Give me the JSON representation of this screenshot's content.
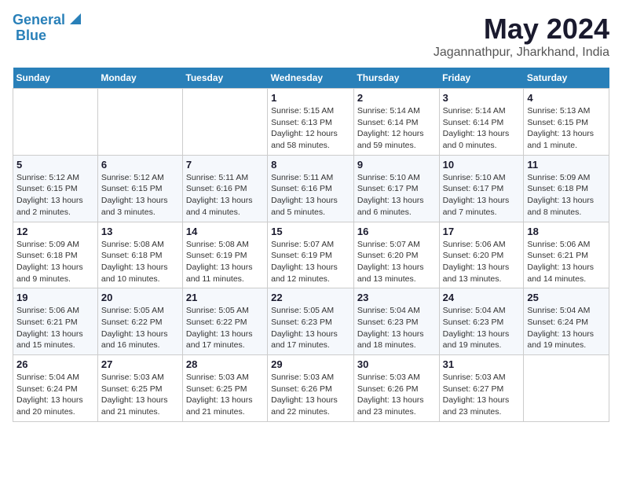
{
  "header": {
    "logo_line1": "General",
    "logo_line2": "Blue",
    "month": "May 2024",
    "location": "Jagannathpur, Jharkhand, India"
  },
  "weekdays": [
    "Sunday",
    "Monday",
    "Tuesday",
    "Wednesday",
    "Thursday",
    "Friday",
    "Saturday"
  ],
  "weeks": [
    [
      {
        "day": "",
        "info": ""
      },
      {
        "day": "",
        "info": ""
      },
      {
        "day": "",
        "info": ""
      },
      {
        "day": "1",
        "info": "Sunrise: 5:15 AM\nSunset: 6:13 PM\nDaylight: 12 hours\nand 58 minutes."
      },
      {
        "day": "2",
        "info": "Sunrise: 5:14 AM\nSunset: 6:14 PM\nDaylight: 12 hours\nand 59 minutes."
      },
      {
        "day": "3",
        "info": "Sunrise: 5:14 AM\nSunset: 6:14 PM\nDaylight: 13 hours\nand 0 minutes."
      },
      {
        "day": "4",
        "info": "Sunrise: 5:13 AM\nSunset: 6:15 PM\nDaylight: 13 hours\nand 1 minute."
      }
    ],
    [
      {
        "day": "5",
        "info": "Sunrise: 5:12 AM\nSunset: 6:15 PM\nDaylight: 13 hours\nand 2 minutes."
      },
      {
        "day": "6",
        "info": "Sunrise: 5:12 AM\nSunset: 6:15 PM\nDaylight: 13 hours\nand 3 minutes."
      },
      {
        "day": "7",
        "info": "Sunrise: 5:11 AM\nSunset: 6:16 PM\nDaylight: 13 hours\nand 4 minutes."
      },
      {
        "day": "8",
        "info": "Sunrise: 5:11 AM\nSunset: 6:16 PM\nDaylight: 13 hours\nand 5 minutes."
      },
      {
        "day": "9",
        "info": "Sunrise: 5:10 AM\nSunset: 6:17 PM\nDaylight: 13 hours\nand 6 minutes."
      },
      {
        "day": "10",
        "info": "Sunrise: 5:10 AM\nSunset: 6:17 PM\nDaylight: 13 hours\nand 7 minutes."
      },
      {
        "day": "11",
        "info": "Sunrise: 5:09 AM\nSunset: 6:18 PM\nDaylight: 13 hours\nand 8 minutes."
      }
    ],
    [
      {
        "day": "12",
        "info": "Sunrise: 5:09 AM\nSunset: 6:18 PM\nDaylight: 13 hours\nand 9 minutes."
      },
      {
        "day": "13",
        "info": "Sunrise: 5:08 AM\nSunset: 6:18 PM\nDaylight: 13 hours\nand 10 minutes."
      },
      {
        "day": "14",
        "info": "Sunrise: 5:08 AM\nSunset: 6:19 PM\nDaylight: 13 hours\nand 11 minutes."
      },
      {
        "day": "15",
        "info": "Sunrise: 5:07 AM\nSunset: 6:19 PM\nDaylight: 13 hours\nand 12 minutes."
      },
      {
        "day": "16",
        "info": "Sunrise: 5:07 AM\nSunset: 6:20 PM\nDaylight: 13 hours\nand 13 minutes."
      },
      {
        "day": "17",
        "info": "Sunrise: 5:06 AM\nSunset: 6:20 PM\nDaylight: 13 hours\nand 13 minutes."
      },
      {
        "day": "18",
        "info": "Sunrise: 5:06 AM\nSunset: 6:21 PM\nDaylight: 13 hours\nand 14 minutes."
      }
    ],
    [
      {
        "day": "19",
        "info": "Sunrise: 5:06 AM\nSunset: 6:21 PM\nDaylight: 13 hours\nand 15 minutes."
      },
      {
        "day": "20",
        "info": "Sunrise: 5:05 AM\nSunset: 6:22 PM\nDaylight: 13 hours\nand 16 minutes."
      },
      {
        "day": "21",
        "info": "Sunrise: 5:05 AM\nSunset: 6:22 PM\nDaylight: 13 hours\nand 17 minutes."
      },
      {
        "day": "22",
        "info": "Sunrise: 5:05 AM\nSunset: 6:23 PM\nDaylight: 13 hours\nand 17 minutes."
      },
      {
        "day": "23",
        "info": "Sunrise: 5:04 AM\nSunset: 6:23 PM\nDaylight: 13 hours\nand 18 minutes."
      },
      {
        "day": "24",
        "info": "Sunrise: 5:04 AM\nSunset: 6:23 PM\nDaylight: 13 hours\nand 19 minutes."
      },
      {
        "day": "25",
        "info": "Sunrise: 5:04 AM\nSunset: 6:24 PM\nDaylight: 13 hours\nand 19 minutes."
      }
    ],
    [
      {
        "day": "26",
        "info": "Sunrise: 5:04 AM\nSunset: 6:24 PM\nDaylight: 13 hours\nand 20 minutes."
      },
      {
        "day": "27",
        "info": "Sunrise: 5:03 AM\nSunset: 6:25 PM\nDaylight: 13 hours\nand 21 minutes."
      },
      {
        "day": "28",
        "info": "Sunrise: 5:03 AM\nSunset: 6:25 PM\nDaylight: 13 hours\nand 21 minutes."
      },
      {
        "day": "29",
        "info": "Sunrise: 5:03 AM\nSunset: 6:26 PM\nDaylight: 13 hours\nand 22 minutes."
      },
      {
        "day": "30",
        "info": "Sunrise: 5:03 AM\nSunset: 6:26 PM\nDaylight: 13 hours\nand 23 minutes."
      },
      {
        "day": "31",
        "info": "Sunrise: 5:03 AM\nSunset: 6:27 PM\nDaylight: 13 hours\nand 23 minutes."
      },
      {
        "day": "",
        "info": ""
      }
    ]
  ]
}
